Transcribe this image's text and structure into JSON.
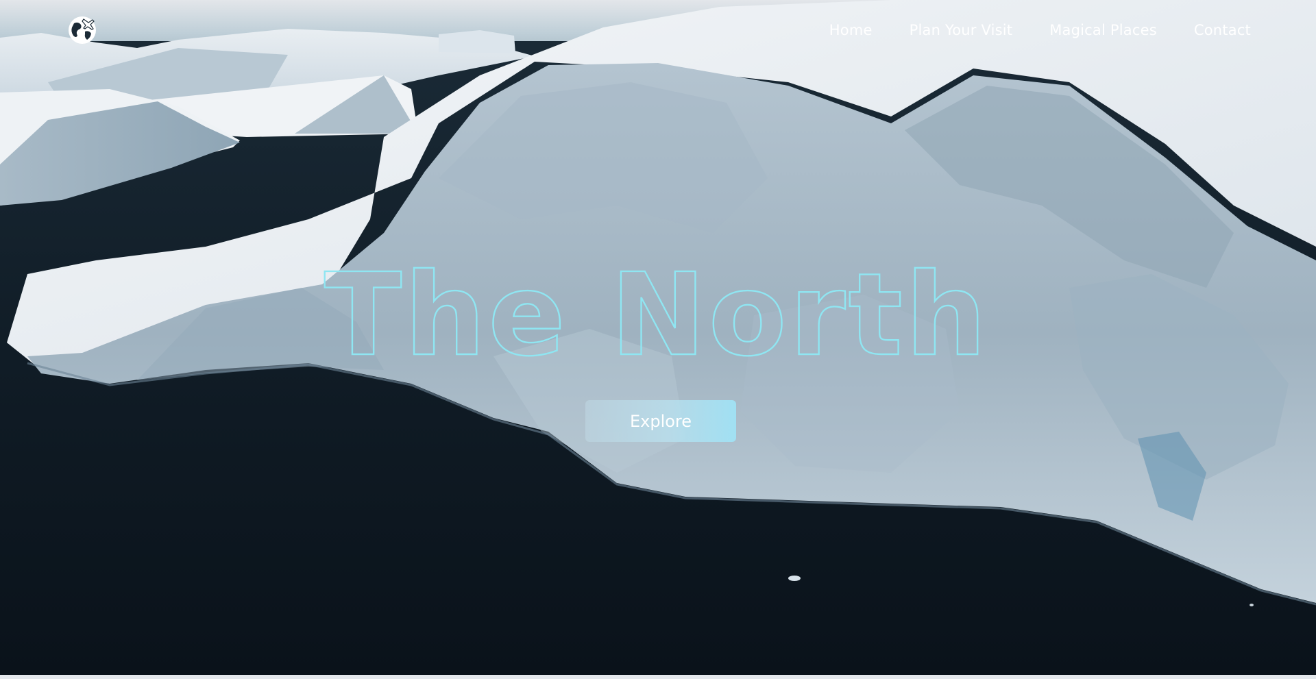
{
  "nav": {
    "items": [
      {
        "label": "Home"
      },
      {
        "label": "Plan Your Visit"
      },
      {
        "label": "Magical Places"
      },
      {
        "label": "Contact"
      }
    ]
  },
  "hero": {
    "title": "The North",
    "button_label": "Explore"
  },
  "icons": {
    "logo": "globe-airplane-icon"
  },
  "colors": {
    "title_outline": "#8fe6f2",
    "nav_text": "#ffffff",
    "ocean": "#0e1a24",
    "ice": "#c9d7e0"
  }
}
